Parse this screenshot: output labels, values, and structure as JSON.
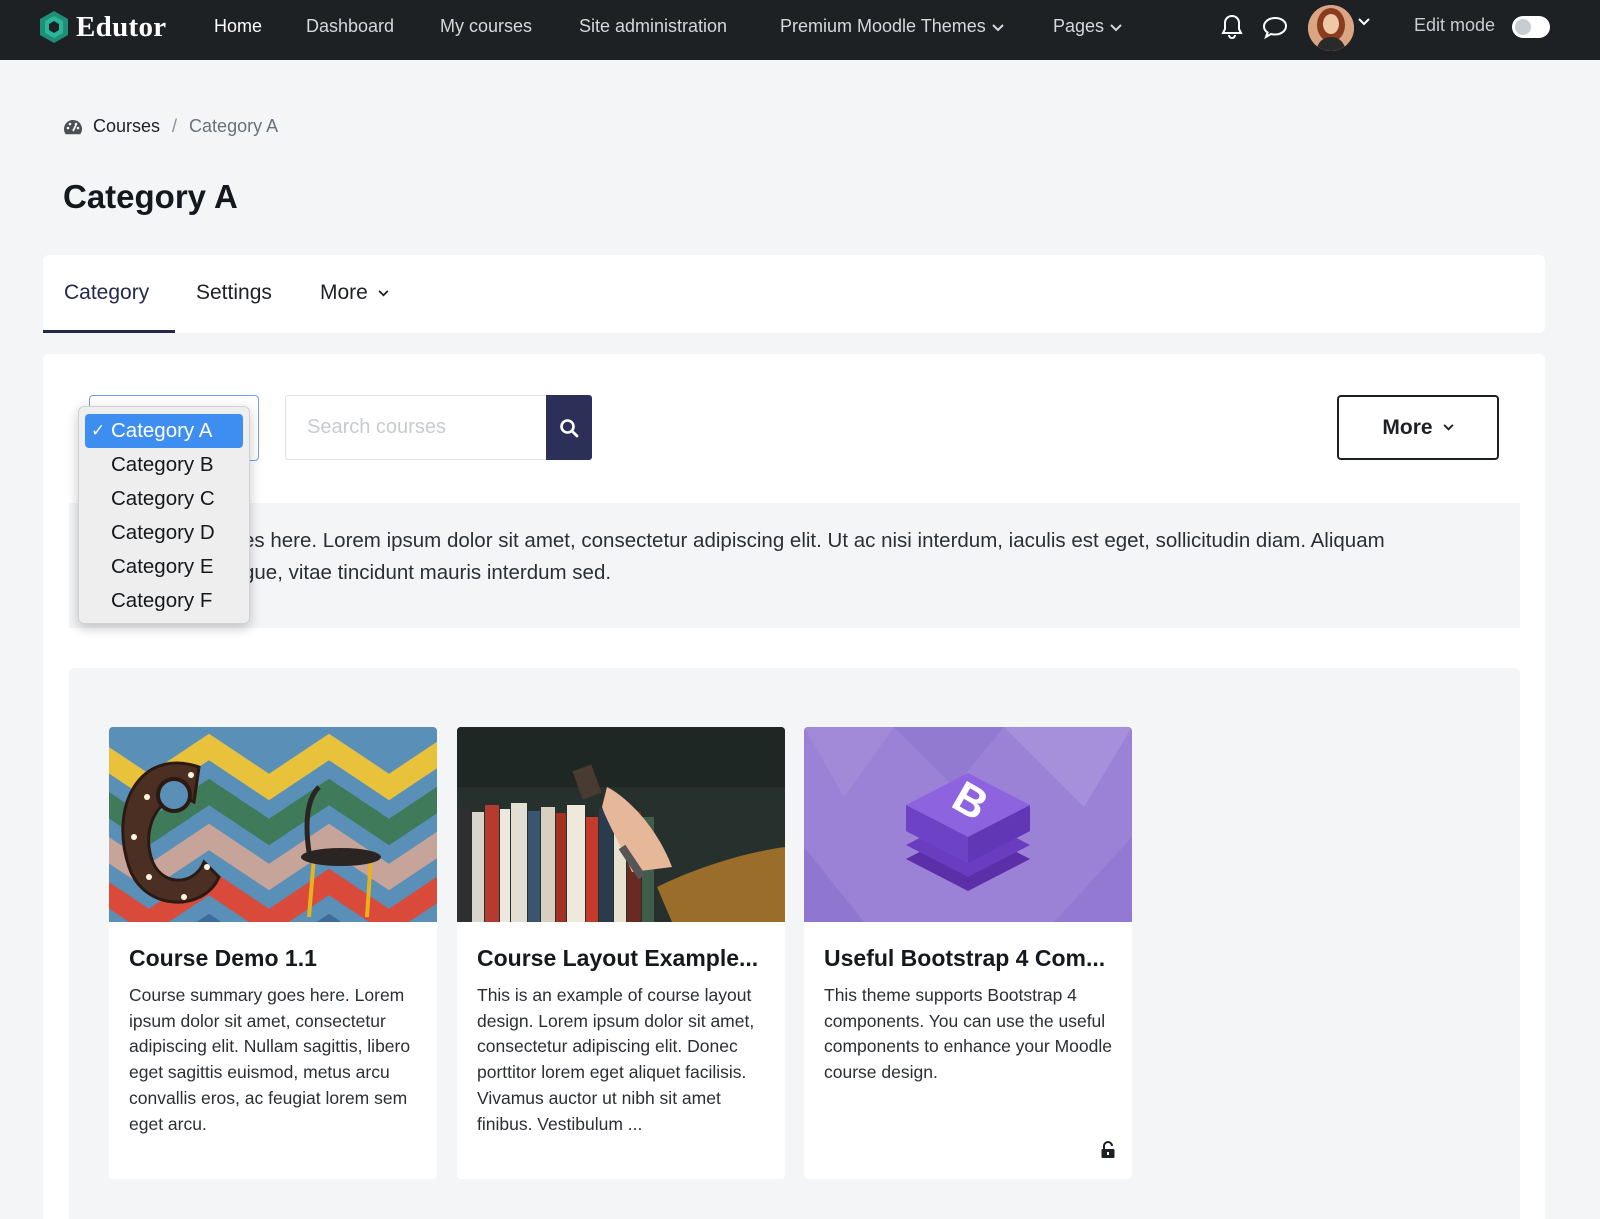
{
  "brand": {
    "name": "Edutor"
  },
  "nav": {
    "items": [
      {
        "label": "Home"
      },
      {
        "label": "Dashboard"
      },
      {
        "label": "My courses"
      },
      {
        "label": "Site administration"
      },
      {
        "label": "Premium Moodle Themes"
      },
      {
        "label": "Pages"
      }
    ],
    "edit_mode_label": "Edit mode",
    "edit_mode_on": false
  },
  "breadcrumb": {
    "items": [
      "Courses",
      "Category A"
    ],
    "separator": "/"
  },
  "page": {
    "title": "Category A"
  },
  "tabs": [
    {
      "label": "Category",
      "active": true
    },
    {
      "label": "Settings"
    },
    {
      "label": "More"
    }
  ],
  "toolbar": {
    "category_select": {
      "selected": "Category A",
      "options": [
        "Category A",
        "Category B",
        "Category C",
        "Category D",
        "Category E",
        "Category F"
      ]
    },
    "search_placeholder": "Search courses",
    "more_label": "More"
  },
  "category_summary": "Category summary goes here. Lorem ipsum dolor sit amet, consectetur adipiscing elit. Ut ac nisi interdum, iaculis est eget, sollicitudin diam. Aliquam et congue, vitae tincidunt mauris interdum sed.",
  "category_summary_visible_tail": [
    "es here. Lorem ipsum dolor sit amet, consectetur adipiscing elit. Ut ac nisi interdum, iaculis est eget, sollicitudin diam. Aliquam",
    "gue, vitae tincidunt mauris interdum sed."
  ],
  "courses": [
    {
      "title": "Course Demo 1.1",
      "summary": "Course summary goes here. Lorem ipsum dolor sit amet, consectetur adipiscing elit. Nullam sagittis, libero eget sagittis euismod, metus arcu convallis eros, ac feugiat lorem sem eget arcu.",
      "image": "letter-c-chair-photo"
    },
    {
      "title": "Course Layout Example...",
      "summary": "This is an example of course layout design. Lorem ipsum dolor sit amet, consectetur adipiscing elit. Donec porttitor lorem eget aliquet facilisis. Vivamus auctor ut nibh sit amet finibus. Vestibulum ...",
      "image": "bookshelf-photo"
    },
    {
      "title": "Useful Bootstrap 4 Com...",
      "summary": "This theme supports Bootstrap 4 components. You can use the useful components to enhance your Moodle course design.",
      "image": "bootstrap-logo",
      "locked_icon": "unlock-icon"
    }
  ],
  "colors": {
    "topbar": "#1e2124",
    "brand_accent": "#2bb59a",
    "primary": "#2c3059",
    "select_highlight": "#3d8ef0",
    "bootstrap_purple": "#7952b3"
  }
}
